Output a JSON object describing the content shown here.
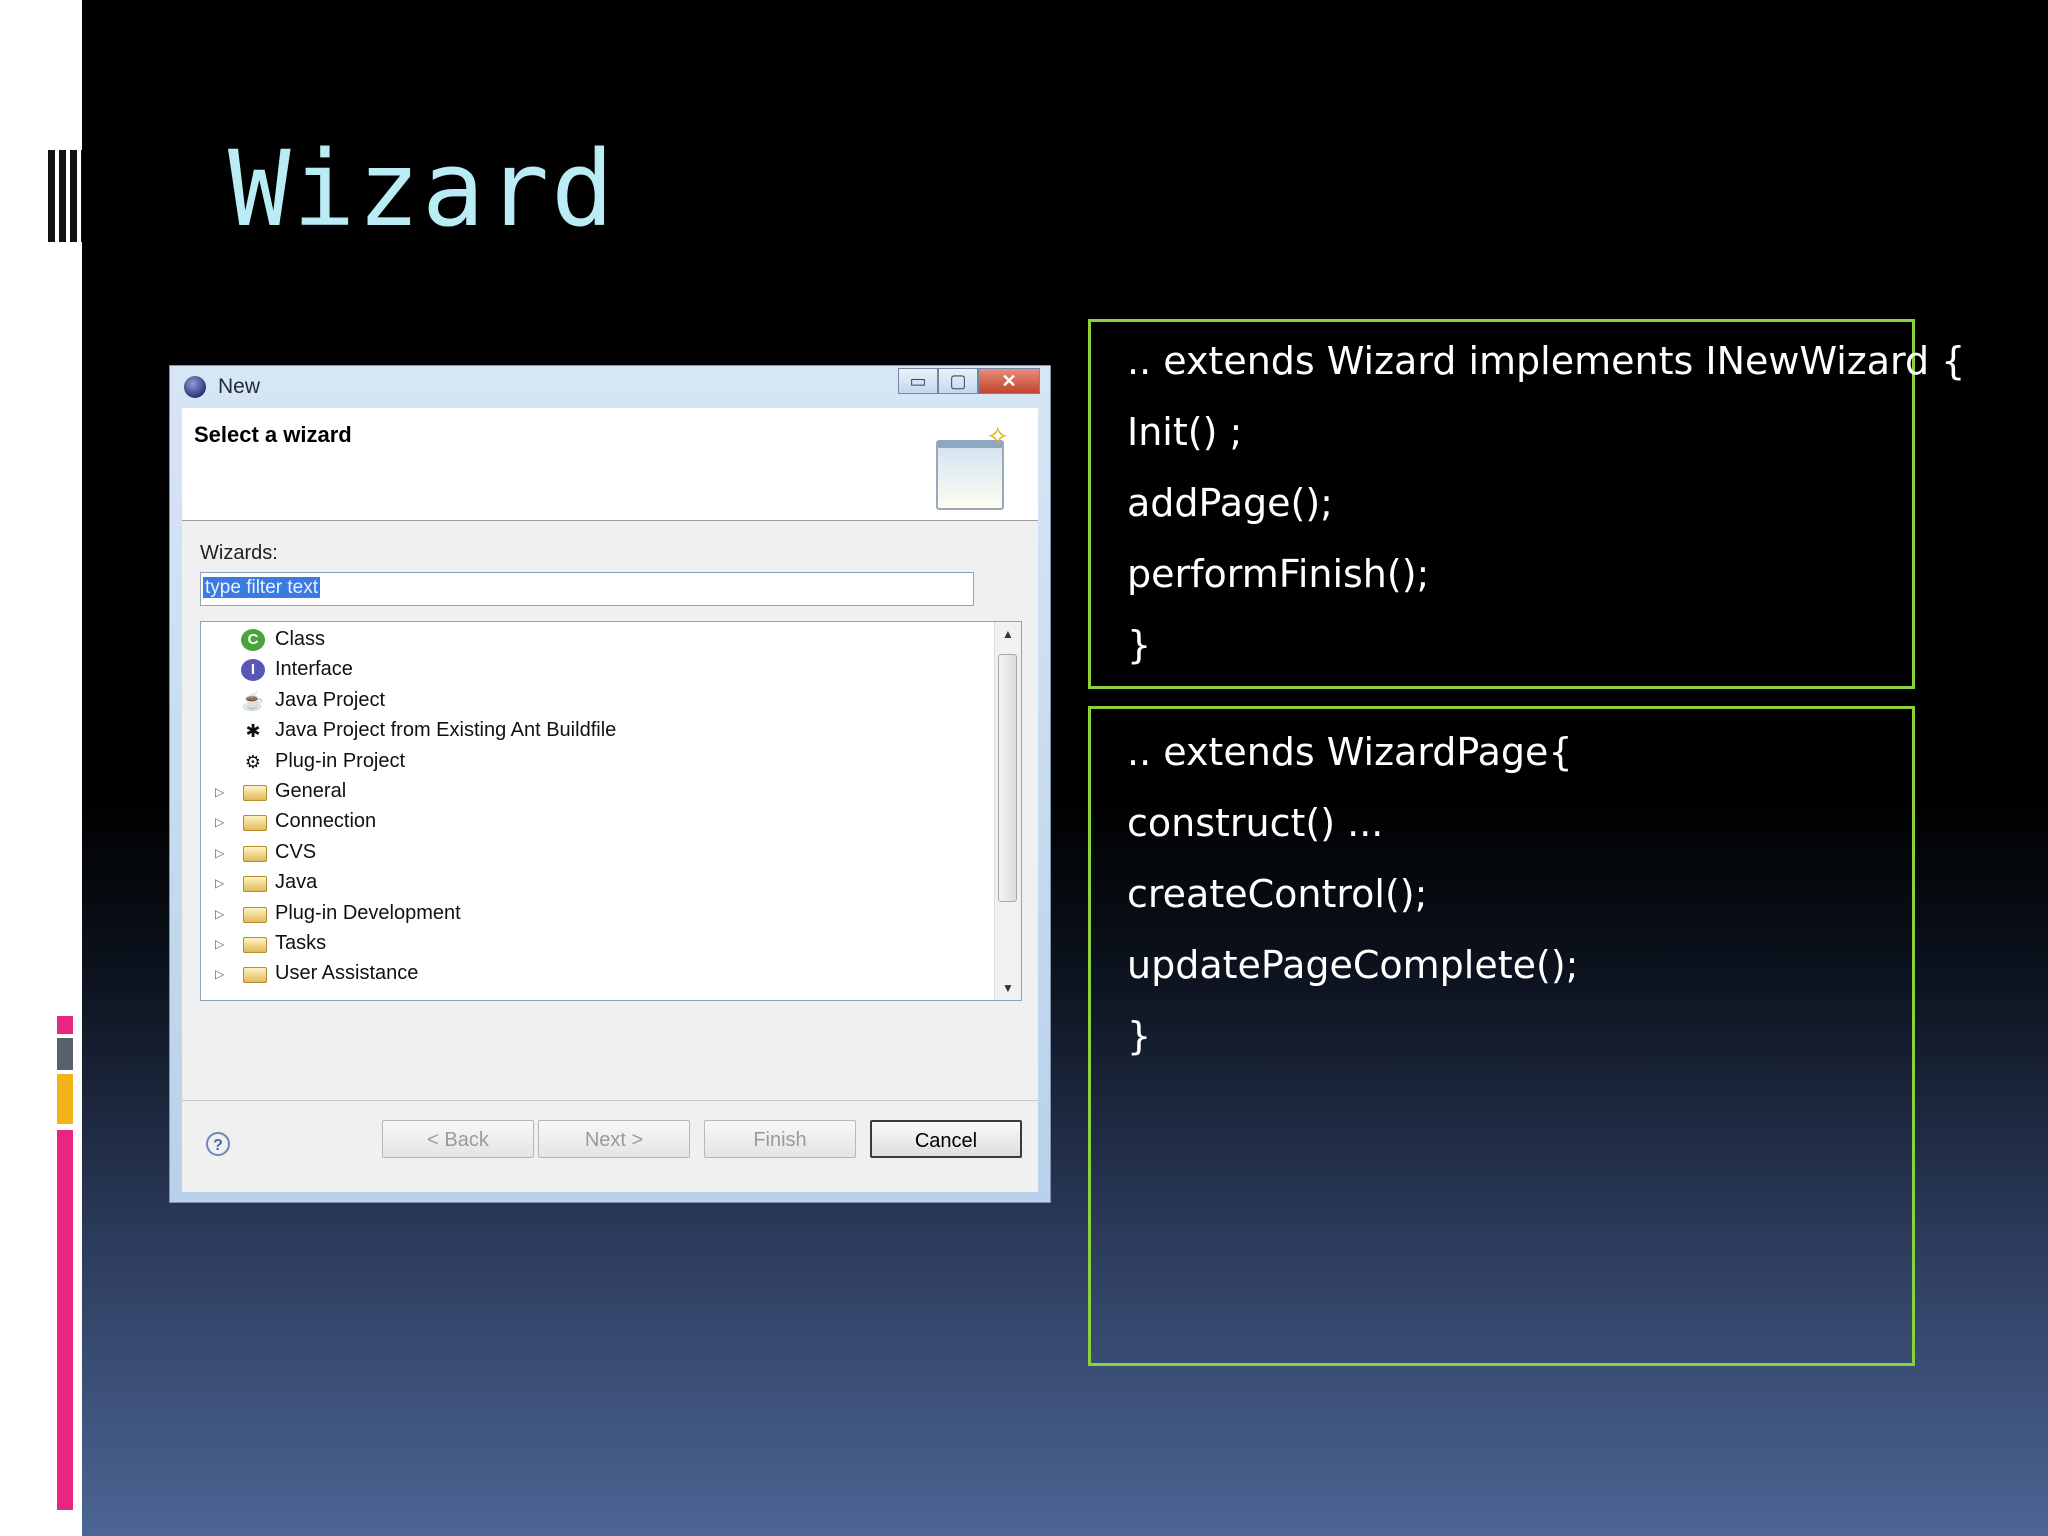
{
  "slide": {
    "title": "Wizard",
    "code_box_1": [
      ".. extends Wizard implements INewWizard {",
      "Init() ;",
      "addPage();",
      "performFinish();",
      "}"
    ],
    "code_box_2": [
      ".. extends WizardPage{",
      "construct()  ...",
      "createControl();",
      "updatePageComplete();",
      "}"
    ],
    "colors": {
      "title": "#b9ecf4",
      "box_border": "#8bd13c",
      "accent_pink": "#e8257f",
      "accent_gray": "#5a5f6e",
      "accent_yellow": "#f2b417"
    }
  },
  "dialog": {
    "window_title": "New",
    "window_buttons": {
      "minimize": "▭",
      "maximize": "▢",
      "close": "✕"
    },
    "header_title": "Select a wizard",
    "wizards_label": "Wizards:",
    "filter_value": "type filter text",
    "tree_items": [
      {
        "label": "Class",
        "icon": "class-icon",
        "expandable": false
      },
      {
        "label": "Interface",
        "icon": "interface-icon",
        "expandable": false
      },
      {
        "label": "Java Project",
        "icon": "java-project-icon",
        "expandable": false
      },
      {
        "label": "Java Project from Existing Ant Buildfile",
        "icon": "ant-icon",
        "expandable": false
      },
      {
        "label": "Plug-in Project",
        "icon": "plugin-project-icon",
        "expandable": false
      },
      {
        "label": "General",
        "icon": "folder-icon",
        "expandable": true
      },
      {
        "label": "Connection",
        "icon": "folder-icon",
        "expandable": true
      },
      {
        "label": "CVS",
        "icon": "folder-icon",
        "expandable": true
      },
      {
        "label": "Java",
        "icon": "folder-icon",
        "expandable": true
      },
      {
        "label": "Plug-in Development",
        "icon": "folder-icon",
        "expandable": true
      },
      {
        "label": "Tasks",
        "icon": "folder-icon",
        "expandable": true
      },
      {
        "label": "User Assistance",
        "icon": "folder-icon",
        "expandable": true
      }
    ],
    "buttons": {
      "help": "?",
      "back": "< Back",
      "next": "Next >",
      "finish": "Finish",
      "cancel": "Cancel"
    }
  }
}
